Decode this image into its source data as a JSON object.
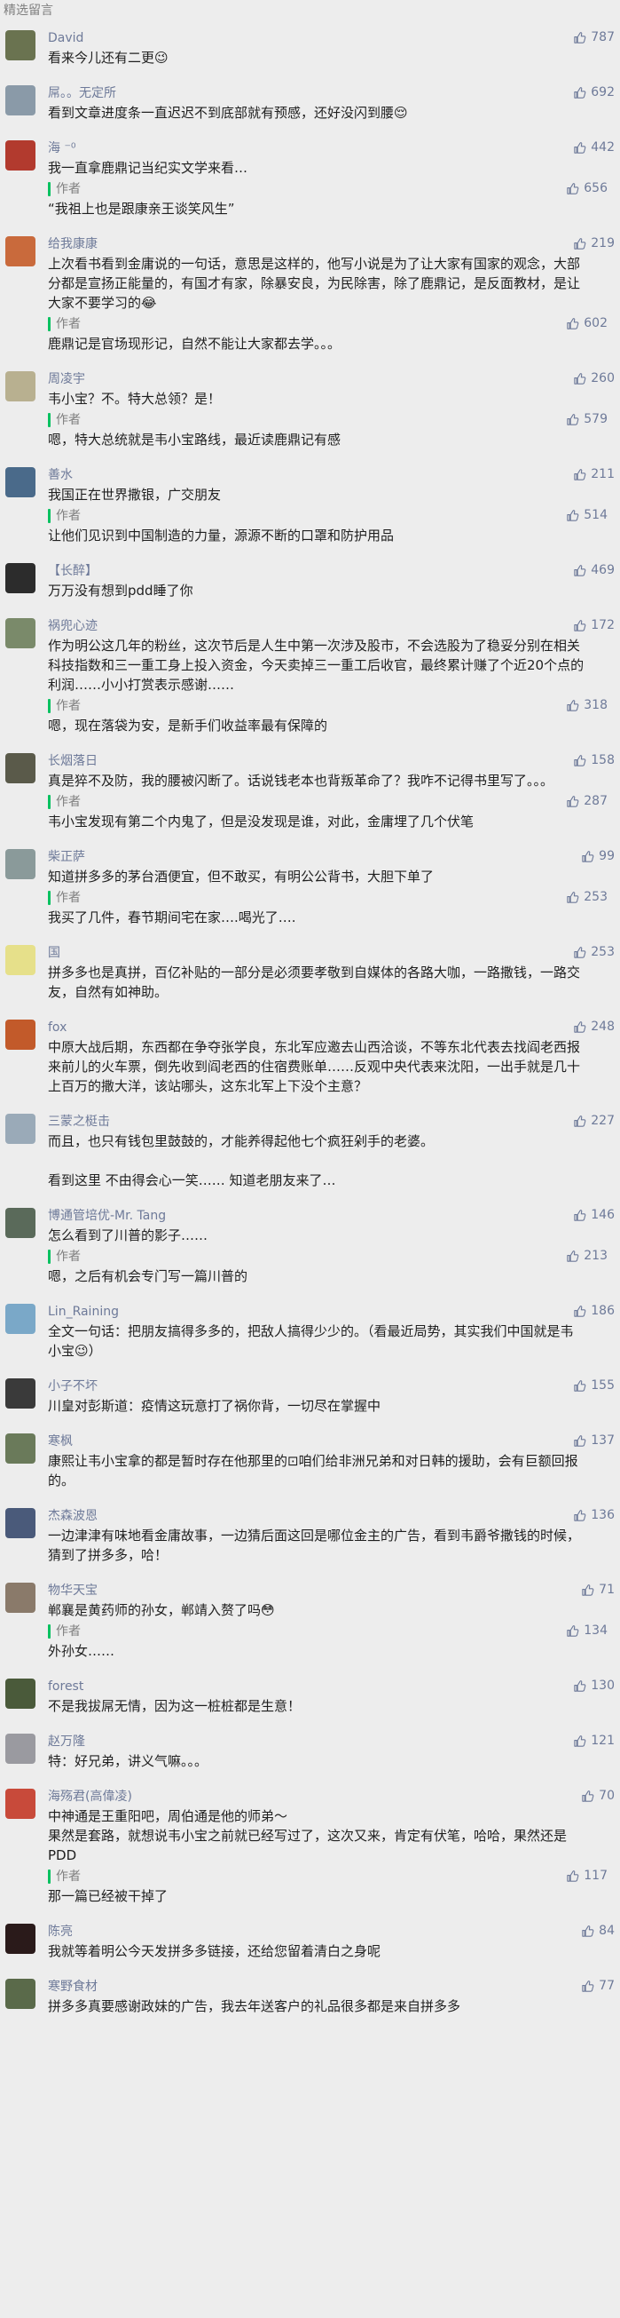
{
  "section_title": "精选留言",
  "author_label": "作者",
  "comments": [
    {
      "name": "David",
      "likes": "787",
      "avatar": "#6a7350",
      "text": "看来今儿还有二更😉"
    },
    {
      "name": "屌。。无定所",
      "likes": "692",
      "avatar": "#8a9aa8",
      "text": "看到文章进度条一直迟迟不到底部就有预感，还好没闪到腰😌"
    },
    {
      "name": "海 ⁻⁰",
      "likes": "442",
      "avatar": "#b23a2e",
      "text": "我一直拿鹿鼎记当纪实文学来看…",
      "reply": {
        "likes": "656",
        "text": "“我祖上也是跟康亲王谈笑风生”"
      }
    },
    {
      "name": "给我康康",
      "likes": "219",
      "avatar": "#c96a3c",
      "text": "上次看书看到金庸说的一句话，意思是这样的，他写小说是为了让大家有国家的观念，大部分都是宣扬正能量的，有国才有家，除暴安良，为民除害，除了鹿鼎记，是反面教材，是让大家不要学习的😂",
      "reply": {
        "likes": "602",
        "text": "鹿鼎记是官场现形记，自然不能让大家都去学。。。"
      }
    },
    {
      "name": "周凌宇",
      "likes": "260",
      "avatar": "#b8b090",
      "text": "韦小宝？不。特大总领？是！",
      "reply": {
        "likes": "579",
        "text": "嗯，特大总统就是韦小宝路线，最近读鹿鼎记有感"
      }
    },
    {
      "name": "善水",
      "likes": "211",
      "avatar": "#4a6a8a",
      "text": "我国正在世界撒银，广交朋友",
      "reply": {
        "likes": "514",
        "text": "让他们见识到中国制造的力量，源源不断的口罩和防护用品"
      }
    },
    {
      "name": "【长醉】",
      "likes": "469",
      "avatar": "#2c2c2c",
      "text": "万万没有想到pdd睡了你"
    },
    {
      "name": "祸兜心迹",
      "likes": "172",
      "avatar": "#7a8a6a",
      "text": "作为明公这几年的粉丝，这次节后是人生中第一次涉及股市，不会选股为了稳妥分别在相关科技指数和三一重工身上投入资金，今天卖掉三一重工后收官，最终累计赚了个近20个点的利润……小小打赏表示感谢……",
      "reply": {
        "likes": "318",
        "text": "嗯，现在落袋为安，是新手们收益率最有保障的"
      }
    },
    {
      "name": "长烟落日",
      "likes": "158",
      "avatar": "#5a5a4a",
      "text": "真是猝不及防，我的腰被闪断了。话说钱老本也背叛革命了？我咋不记得书里写了。。。",
      "reply": {
        "likes": "287",
        "text": "韦小宝发现有第二个内鬼了，但是没发现是谁，对此，金庸埋了几个伏笔"
      }
    },
    {
      "name": "柴正萨",
      "likes": "99",
      "avatar": "#8a9a9a",
      "text": "知道拼多多的茅台酒便宜，但不敢买，有明公公背书，大胆下单了",
      "reply": {
        "likes": "253",
        "text": "我买了几件，春节期间宅在家….喝光了…."
      }
    },
    {
      "name": "国",
      "likes": "253",
      "avatar": "#e6e08a",
      "text": "拼多多也是真拼，百亿补贴的一部分是必须要孝敬到自媒体的各路大咖，一路撒钱，一路交友，自然有如神助。"
    },
    {
      "name": "fox",
      "likes": "248",
      "avatar": "#c25a2a",
      "text": "中原大战后期，东西都在争夺张学良，东北军应邀去山西洽谈，不等东北代表去找阎老西报来前儿的火车票，倒先收到阎老西的住宿费账单……反观中央代表来沈阳，一出手就是几十上百万的撒大洋，该站哪头，这东北军上下没个主意？"
    },
    {
      "name": "三蒙之梃击",
      "likes": "227",
      "avatar": "#9aaab8",
      "text": "而且，也只有钱包里鼓鼓的，才能养得起他七个疯狂剁手的老婆。\n\n看到这里 不由得会心一笑…… 知道老朋友来了…"
    },
    {
      "name": "博通管培优-Mr. Tang",
      "likes": "146",
      "avatar": "#5a6a5a",
      "text": "怎么看到了川普的影子……",
      "reply": {
        "likes": "213",
        "text": "嗯，之后有机会专门写一篇川普的"
      }
    },
    {
      "name": "Lin_Raining",
      "likes": "186",
      "avatar": "#7aa8c8",
      "text": "全文一句话：把朋友搞得多多的，把敌人搞得少少的。（看最近局势，其实我们中国就是韦小宝😉）"
    },
    {
      "name": "小子不坏",
      "likes": "155",
      "avatar": "#3a3a3a",
      "text": "川皇对彭斯道：疫情这玩意打了祸你背，一切尽在掌握中"
    },
    {
      "name": "寒枫",
      "likes": "137",
      "avatar": "#6a7a5a",
      "text": "康熙让韦小宝拿的都是暂时存在他那里的⊡咱们给非洲兄弟和对日韩的援助，会有巨额回报的。"
    },
    {
      "name": "杰森波恩",
      "likes": "136",
      "avatar": "#4a5a7a",
      "text": "一边津津有味地看金庸故事，一边猜后面这回是哪位金主的广告，看到韦爵爷撒钱的时候，猜到了拼多多，哈！"
    },
    {
      "name": "物华天宝",
      "likes": "71",
      "avatar": "#8a7a6a",
      "text": "郸襄是黄药师的孙女，郸靖入赘了吗😳",
      "reply": {
        "likes": "134",
        "text": "外孙女……"
      }
    },
    {
      "name": "forest",
      "likes": "130",
      "avatar": "#4a5a3a",
      "text": "不是我拔屌无情，因为这一桩桩都是生意！"
    },
    {
      "name": "赵万隆",
      "likes": "121",
      "avatar": "#9a9aa0",
      "text": "特：好兄弟，讲义气嘛。。。"
    },
    {
      "name": "海殇君(高偉凌)",
      "likes": "70",
      "avatar": "#c84a3a",
      "text": "中神通是王重阳吧，周伯通是他的师弟～\n果然是套路，就想说韦小宝之前就已经写过了，这次又来，肯定有伏笔，哈哈，果然还是PDD",
      "reply": {
        "likes": "117",
        "text": "那一篇已经被干掉了"
      }
    },
    {
      "name": "陈亮",
      "likes": "84",
      "avatar": "#2a1a1a",
      "text": "我就等着明公今天发拼多多链接，还给您留着清白之身呢"
    },
    {
      "name": "寒野食材",
      "likes": "77",
      "avatar": "#5a6a4a",
      "text": "拼多多真要感谢政妹的广告，我去年送客户的礼品很多都是来自拼多多"
    }
  ]
}
